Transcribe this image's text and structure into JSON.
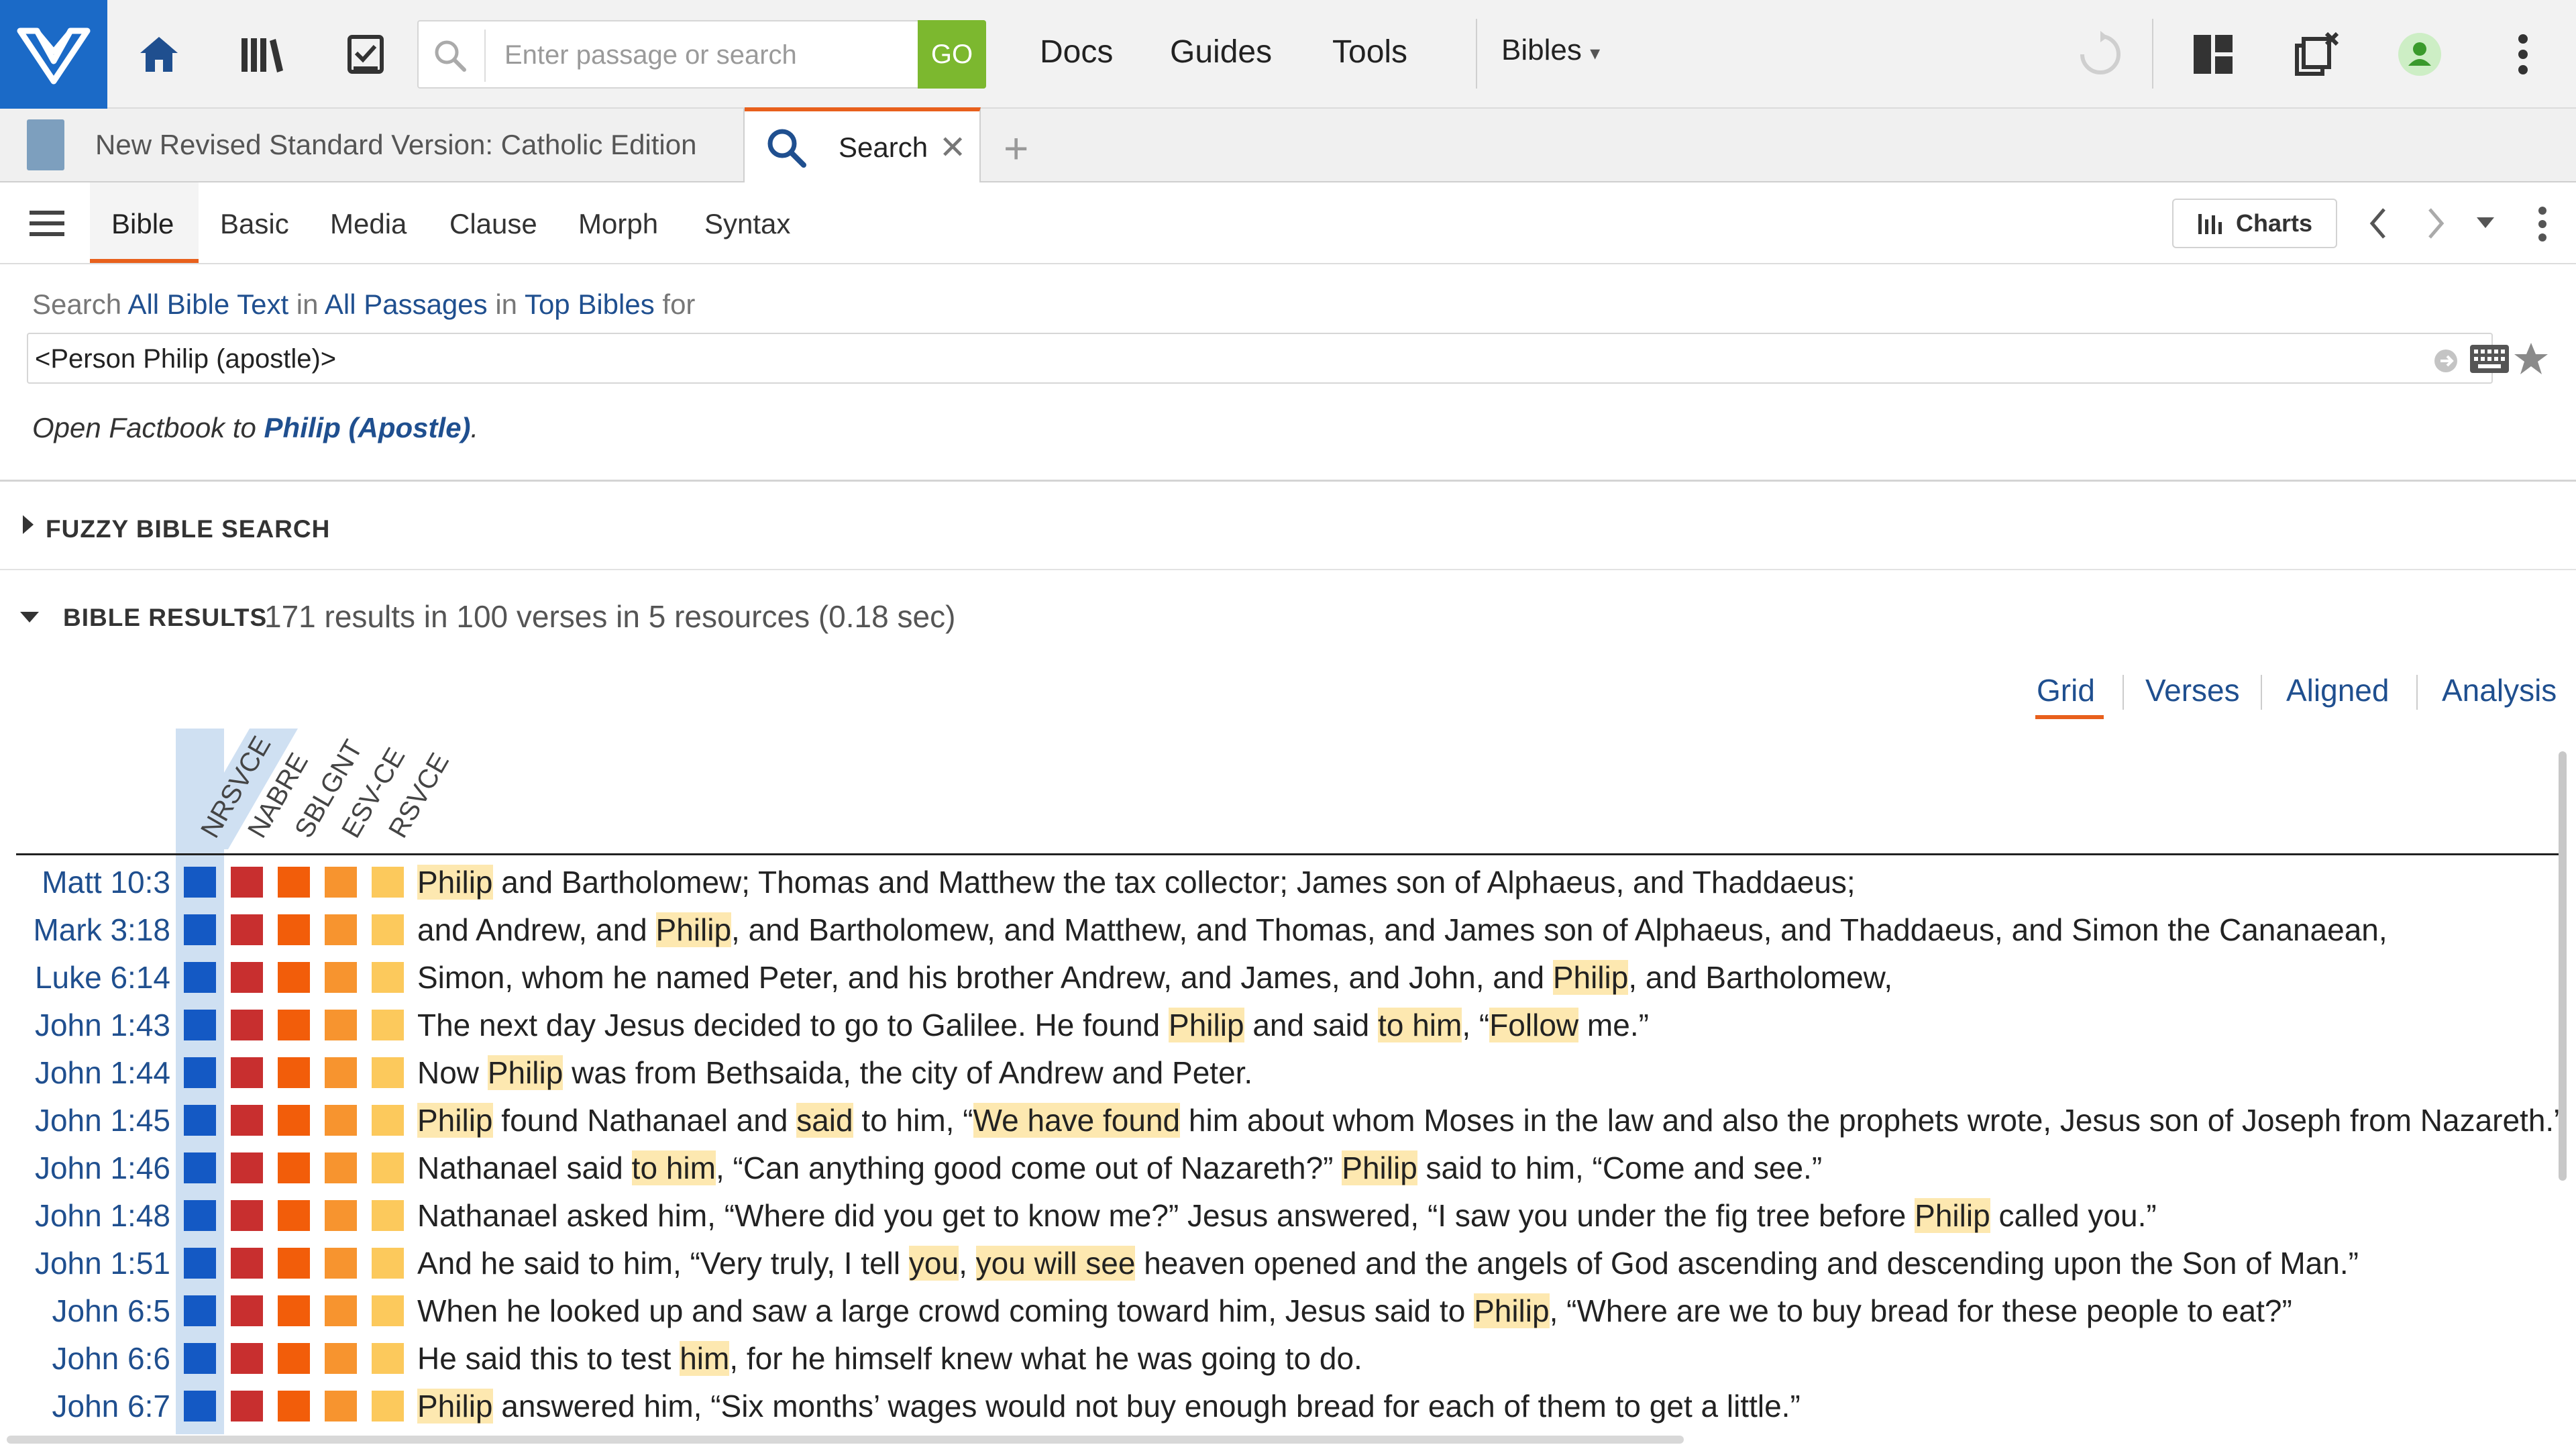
{
  "topbar": {
    "search_placeholder": "Enter passage or search",
    "go_label": "GO",
    "menu": [
      "Docs",
      "Guides",
      "Tools"
    ],
    "bibles_label": "Bibles",
    "bibles_caret": "▾"
  },
  "tabs": {
    "tab1_label": "New Revised Standard Version: Catholic Edition",
    "tab2_label": "Search",
    "close_glyph": "✕",
    "add_glyph": "+"
  },
  "search_toolbar": {
    "tabs": [
      "Bible",
      "Basic",
      "Media",
      "Clause",
      "Morph",
      "Syntax"
    ],
    "active_tab": "Bible",
    "charts_label": "Charts"
  },
  "query": {
    "prefix": "Search",
    "scope_text": "All Bible Text",
    "in1": "in",
    "passages": "All Passages",
    "in2": "in",
    "resources": "Top Bibles",
    "for": "for",
    "value": "<Person Philip (apostle)>",
    "factbook_prefix": "Open Factbook to",
    "factbook_link": "Philip (Apostle)",
    "factbook_suffix": "."
  },
  "fuzzy": {
    "label": "FUZZY BIBLE SEARCH"
  },
  "results": {
    "label": "BIBLE RESULTS",
    "summary": "171 results in 100 verses in 5 resources (0.18 sec)",
    "view_tabs": [
      "Grid",
      "Verses",
      "Aligned",
      "Analysis"
    ],
    "active_view": "Grid",
    "columns": [
      "NRSVCE",
      "NABRE",
      "SBLGNT",
      "ESV-CE",
      "RSVCE"
    ],
    "column_colors": [
      "#1459c4",
      "#c82f2f",
      "#f25d0a",
      "#f7942f",
      "#fcc95c"
    ],
    "rows": [
      {
        "ref": "Matt 10:3",
        "text": [
          {
            "t": "Philip",
            "h": true
          },
          {
            "t": " and Bartholomew; Thomas and Matthew the tax collector; James son of Alphaeus, and Thaddaeus;",
            "h": false
          }
        ]
      },
      {
        "ref": "Mark 3:18",
        "text": [
          {
            "t": "and Andrew, and ",
            "h": false
          },
          {
            "t": "Philip",
            "h": true
          },
          {
            "t": ", and Bartholomew, and Matthew, and Thomas, and James son of Alphaeus, and Thaddaeus, and Simon the Cananaean,",
            "h": false
          }
        ]
      },
      {
        "ref": "Luke 6:14",
        "text": [
          {
            "t": "Simon, whom he named Peter, and his brother Andrew, and James, and John, and ",
            "h": false
          },
          {
            "t": "Philip",
            "h": true
          },
          {
            "t": ", and Bartholomew,",
            "h": false
          }
        ]
      },
      {
        "ref": "John 1:43",
        "text": [
          {
            "t": "The next day Jesus decided to go to Galilee. He found ",
            "h": false
          },
          {
            "t": "Philip",
            "h": true
          },
          {
            "t": " and said ",
            "h": false
          },
          {
            "t": "to him",
            "h": true
          },
          {
            "t": ", “",
            "h": false
          },
          {
            "t": "Follow",
            "h": true
          },
          {
            "t": " me.”",
            "h": false
          }
        ]
      },
      {
        "ref": "John 1:44",
        "text": [
          {
            "t": "Now ",
            "h": false
          },
          {
            "t": "Philip",
            "h": true
          },
          {
            "t": " was from Bethsaida, the city of Andrew and Peter.",
            "h": false
          }
        ]
      },
      {
        "ref": "John 1:45",
        "text": [
          {
            "t": "Philip",
            "h": true
          },
          {
            "t": " found Nathanael and ",
            "h": false
          },
          {
            "t": "said",
            "h": true
          },
          {
            "t": " to him, “",
            "h": false
          },
          {
            "t": "We have found",
            "h": true
          },
          {
            "t": " him about whom Moses in the law and also the prophets wrote, Jesus son of Joseph from Nazareth.”",
            "h": false
          }
        ]
      },
      {
        "ref": "John 1:46",
        "text": [
          {
            "t": "Nathanael said ",
            "h": false
          },
          {
            "t": "to him",
            "h": true
          },
          {
            "t": ", “Can anything good come out of Nazareth?” ",
            "h": false
          },
          {
            "t": "Philip",
            "h": true
          },
          {
            "t": " said to him, “Come and see.”",
            "h": false
          }
        ]
      },
      {
        "ref": "John 1:48",
        "text": [
          {
            "t": "Nathanael asked him, “Where did you get to know me?” Jesus answered, “I saw you under the fig tree before ",
            "h": false
          },
          {
            "t": "Philip",
            "h": true
          },
          {
            "t": " called you.”",
            "h": false
          }
        ]
      },
      {
        "ref": "John 1:51",
        "text": [
          {
            "t": "And he said to him, “Very truly, I tell ",
            "h": false
          },
          {
            "t": "you",
            "h": true
          },
          {
            "t": ", ",
            "h": false
          },
          {
            "t": "you will see",
            "h": true
          },
          {
            "t": " heaven opened and the angels of God ascending and descending upon the Son of Man.”",
            "h": false
          }
        ]
      },
      {
        "ref": "John 6:5",
        "text": [
          {
            "t": "When he looked up and saw a large crowd coming toward him, Jesus said to ",
            "h": false
          },
          {
            "t": "Philip",
            "h": true
          },
          {
            "t": ", “Where are we to buy bread for these people to eat?”",
            "h": false
          }
        ]
      },
      {
        "ref": "John 6:6",
        "text": [
          {
            "t": "He said this to test ",
            "h": false
          },
          {
            "t": "him",
            "h": true
          },
          {
            "t": ", for he himself knew what he was going to do.",
            "h": false
          }
        ]
      },
      {
        "ref": "John 6:7",
        "text": [
          {
            "t": "Philip",
            "h": true
          },
          {
            "t": " answered him, “Six months’ wages would not buy enough bread for each of them to get a little.”",
            "h": false
          }
        ]
      }
    ]
  }
}
